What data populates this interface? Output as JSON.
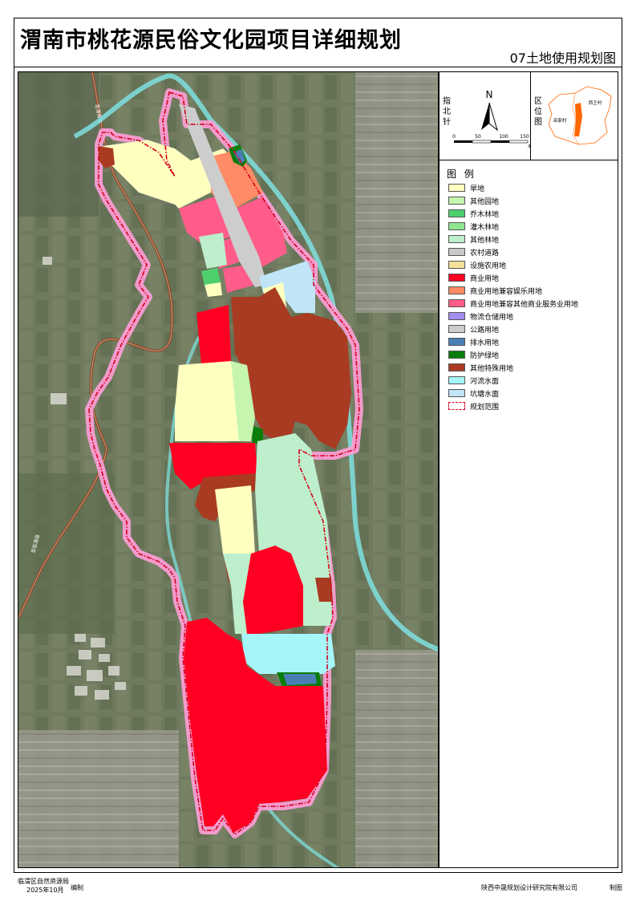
{
  "title": "渭南市桃花源民俗文化园项目详细规划",
  "subtitle": "07土地使用规划图",
  "north_arrow": {
    "label": "指北针",
    "north_letter": "N",
    "scale_ticks": [
      "0",
      "50",
      "100",
      "150"
    ],
    "scale_unit": "米"
  },
  "location_map": {
    "label": "区位图",
    "village_west": "岳家村",
    "village_east": "西王村",
    "accent_color": "#ff6600"
  },
  "legend": {
    "title": "图 例",
    "items": [
      {
        "label": "旱地",
        "color": "#ffffc0"
      },
      {
        "label": "其他园地",
        "color": "#c6f5b0"
      },
      {
        "label": "乔木林地",
        "color": "#4ecf6e"
      },
      {
        "label": "灌木林地",
        "color": "#8ee68e"
      },
      {
        "label": "其他林地",
        "color": "#bdefcc"
      },
      {
        "label": "农村道路",
        "color": "#c8c8c8"
      },
      {
        "label": "设施农用地",
        "color": "#f3e09a"
      },
      {
        "label": "商业用地",
        "color": "#ff0022"
      },
      {
        "label": "商业用地兼容娱乐用地",
        "color": "#ff8c66"
      },
      {
        "label": "商业用地兼容其他商业服务业用地",
        "color": "#ff5c8a"
      },
      {
        "label": "物流仓储用地",
        "color": "#a48cf0"
      },
      {
        "label": "公路用地",
        "color": "#cdcdcd"
      },
      {
        "label": "排水用地",
        "color": "#4a7fb5"
      },
      {
        "label": "防护绿地",
        "color": "#0a7d0a"
      },
      {
        "label": "其他特殊用地",
        "color": "#a93b22"
      },
      {
        "label": "河流水面",
        "color": "#a6f5f7"
      },
      {
        "label": "坑塘水面",
        "color": "#bfe5f7"
      },
      {
        "label": "规划范围",
        "color": "#d6001c"
      }
    ]
  },
  "map_labels": {
    "road_name_1": "至渭南市",
    "road_name_2": "至临渭县"
  },
  "footer": {
    "agency": "临渭区自然资源局",
    "date": "2025年10月",
    "compiled": "编制",
    "institute": "陕西中晟规划设计研究院有限公司",
    "drawn": "制图"
  }
}
